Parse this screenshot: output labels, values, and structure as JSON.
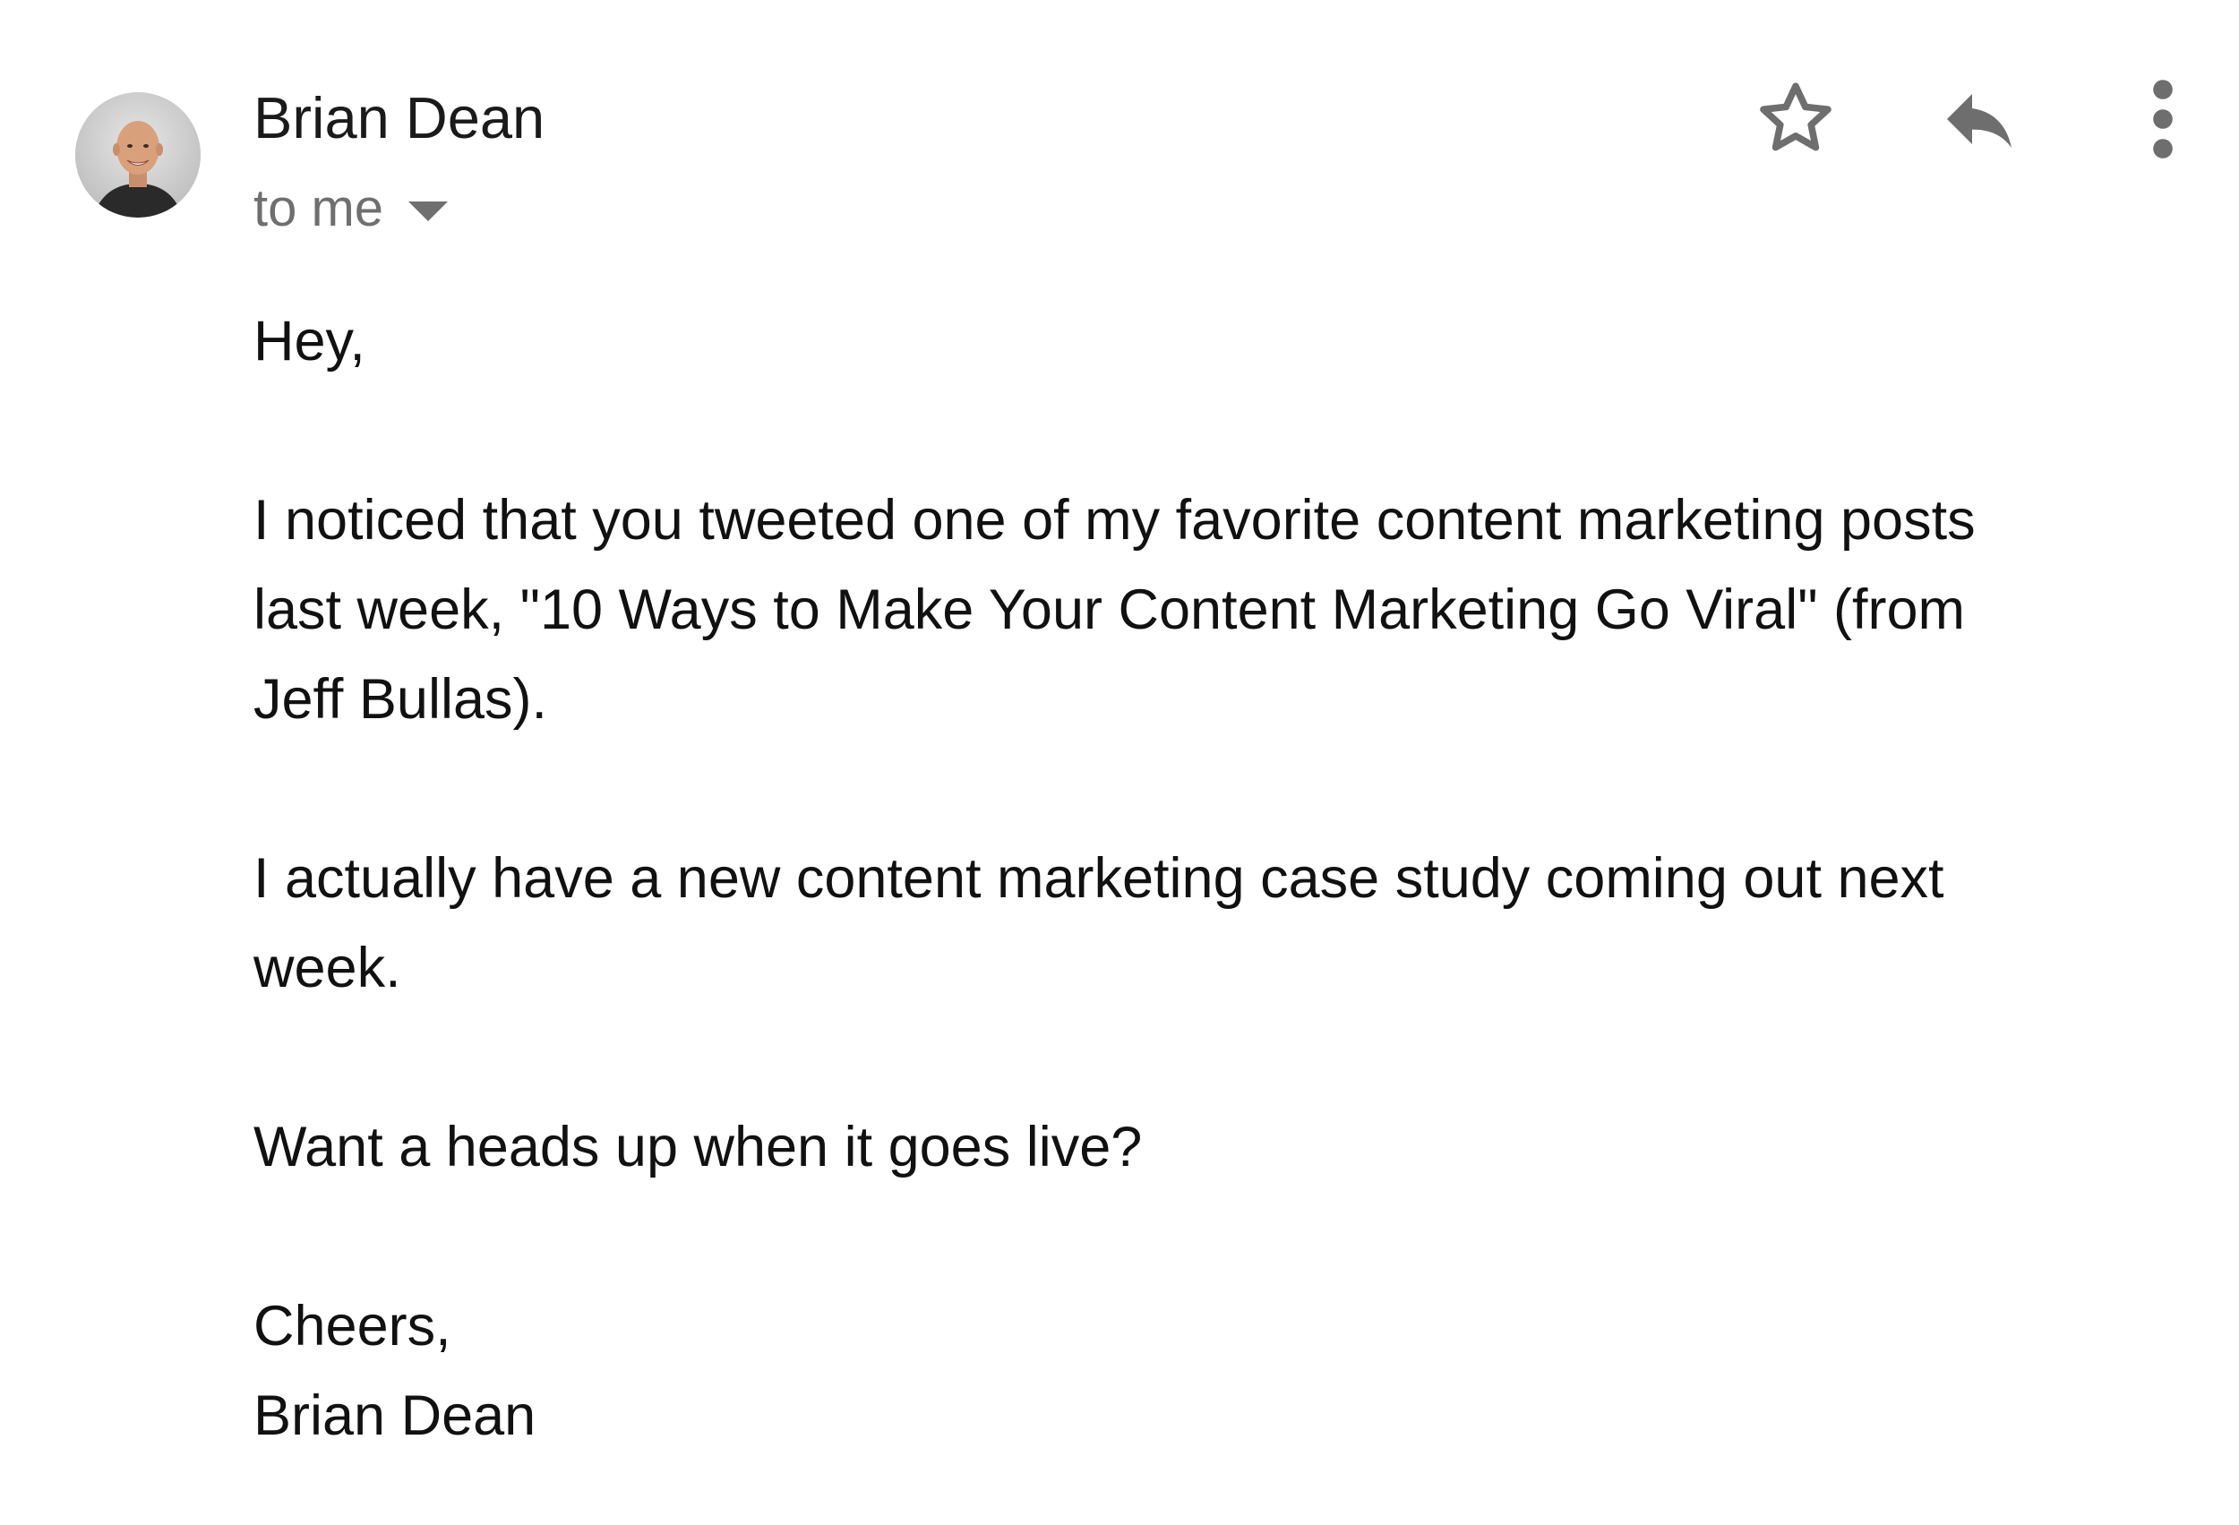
{
  "email": {
    "sender_name": "Brian Dean",
    "recipient_label": "to me",
    "paragraphs": [
      "Hey,",
      "I noticed that you tweeted one of my favorite content marketing posts\nlast week, \"10 Ways to Make Your Content Marketing Go Viral\" (from\nJeff Bullas).",
      "I actually have a new content marketing case study coming out next\nweek.",
      "Want a heads up when it goes live?",
      "Cheers,\nBrian Dean"
    ]
  },
  "toolbar": {
    "icons": [
      "star-icon",
      "reply-icon",
      "more-vert-icon"
    ]
  },
  "colors": {
    "text": "#111111",
    "muted": "#6f6f6f",
    "icon": "#6e6e6e",
    "background": "#ffffff"
  }
}
